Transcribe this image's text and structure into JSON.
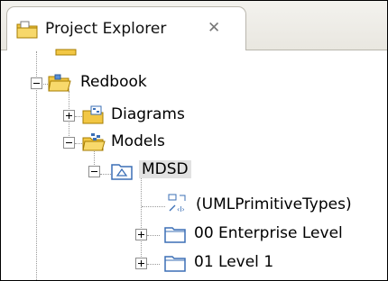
{
  "view": {
    "title": "Project Explorer",
    "close_glyph": "✕"
  },
  "tree": {
    "root": {
      "label": "Redbook",
      "expanded": true,
      "icon": "project-folder-icon"
    },
    "diagrams": {
      "label": "Diagrams",
      "expanded": false,
      "icon": "diagrams-folder-icon"
    },
    "models": {
      "label": "Models",
      "expanded": true,
      "icon": "models-folder-icon"
    },
    "mdsd": {
      "label": "MDSD",
      "expanded": true,
      "icon": "model-icon",
      "selected": true
    },
    "primitive": {
      "label": "(UMLPrimitiveTypes)",
      "icon": "model-library-icon"
    },
    "enterprise": {
      "label": "00 Enterprise Level",
      "expanded": false,
      "icon": "package-icon"
    },
    "level1": {
      "label": "01 Level 1",
      "expanded": false,
      "icon": "package-icon"
    }
  },
  "colors": {
    "folder": "#f2c744",
    "package": "#3b6fb6",
    "selection": "#e2e2e2"
  }
}
